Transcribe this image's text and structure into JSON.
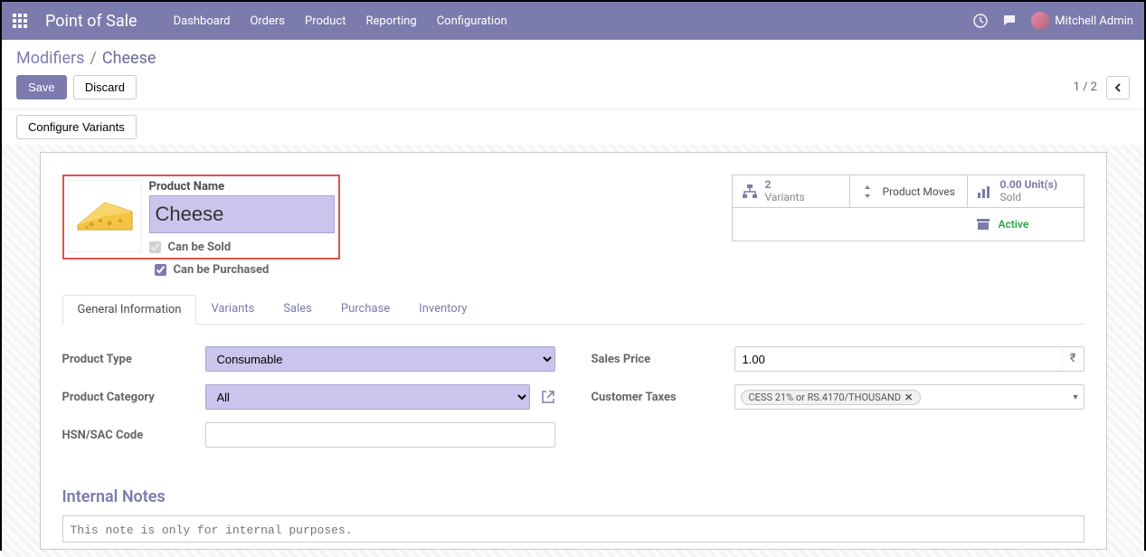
{
  "nav": {
    "brand": "Point of Sale",
    "items": [
      "Dashboard",
      "Orders",
      "Product",
      "Reporting",
      "Configuration"
    ],
    "user": "Mitchell Admin"
  },
  "breadcrumb": {
    "parent": "Modifiers",
    "sep": "/",
    "current": "Cheese"
  },
  "buttons": {
    "save": "Save",
    "discard": "Discard",
    "configure_variants": "Configure Variants"
  },
  "pager": {
    "text": "1 / 2"
  },
  "product": {
    "name_label": "Product Name",
    "name_value": "Cheese",
    "can_be_sold": "Can be Sold",
    "can_be_purchased": "Can be Purchased"
  },
  "stats": {
    "variants_count": "2",
    "variants_label": "Variants",
    "product_moves": "Product Moves",
    "sold_value": "0.00 Unit(s)",
    "sold_label": "Sold",
    "active": "Active"
  },
  "tabs": [
    "General Information",
    "Variants",
    "Sales",
    "Purchase",
    "Inventory"
  ],
  "form": {
    "product_type_label": "Product Type",
    "product_type_value": "Consumable",
    "product_category_label": "Product Category",
    "product_category_value": "All",
    "hsn_label": "HSN/SAC Code",
    "hsn_value": "",
    "sales_price_label": "Sales Price",
    "sales_price_value": "1.00",
    "currency": "₹",
    "customer_taxes_label": "Customer Taxes",
    "customer_taxes_tag": "CESS 21% or RS.4170/THOUSAND"
  },
  "notes": {
    "title": "Internal Notes",
    "placeholder": "This note is only for internal purposes."
  }
}
